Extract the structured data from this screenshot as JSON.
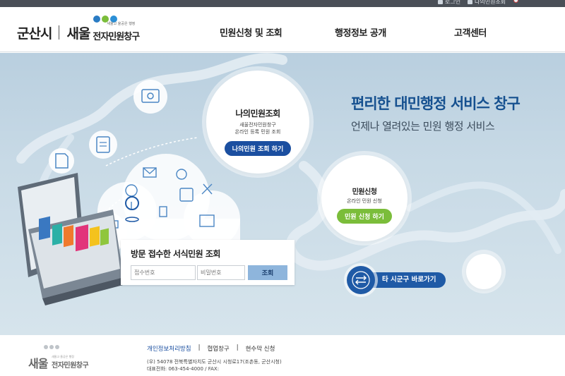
{
  "topbar": {
    "login": "로그인",
    "my_inquiry": "나의민원조회"
  },
  "header": {
    "city": "군산시",
    "saeul": "새울",
    "tagline": "새울고 울공은 행정",
    "brand": "전자민원창구",
    "dot_colors": [
      "#2a7cc4",
      "#7bbd3a",
      "#2b8fd6"
    ]
  },
  "nav": {
    "items": [
      "민원신청 및 조회",
      "행정정보 공개",
      "고객센터"
    ]
  },
  "hero": {
    "headline": "편리한 대민행정 서비스 창구",
    "subline": "언제나 열려있는 민원 행정 서비스",
    "my_inquiry_card": {
      "title": "나의민원조회",
      "desc_line1": "새울전자민원창구",
      "desc_line2": "온라인 등록 민원 조회",
      "button": "나의민원 조회 하기"
    },
    "apply_card": {
      "title": "민원신청",
      "desc": "온라인 민원 신청",
      "button": "민원 신청 하기"
    },
    "search": {
      "label": "방문 접수한 서식민원 조회",
      "receipt_placeholder": "접수번호",
      "password_placeholder": "비밀번호",
      "submit": "조회"
    },
    "other_region": "타 시군구 바로가기"
  },
  "footer": {
    "saeul": "새울",
    "tagline": "새울고 울공은 행정",
    "brand": "전자민원창구",
    "links": [
      "개인정보처리방침",
      "협업창구",
      "현수막 신청"
    ],
    "address": "(우) 54078 전북특별자치도 군산시 시청로17(조촌동, 군산시청)",
    "phone": "대표전화: 063-454-4000 / FAX:"
  },
  "colors": {
    "primary_blue": "#1b4fa0",
    "headline_blue": "#15508f",
    "green": "#7bbd3a"
  }
}
